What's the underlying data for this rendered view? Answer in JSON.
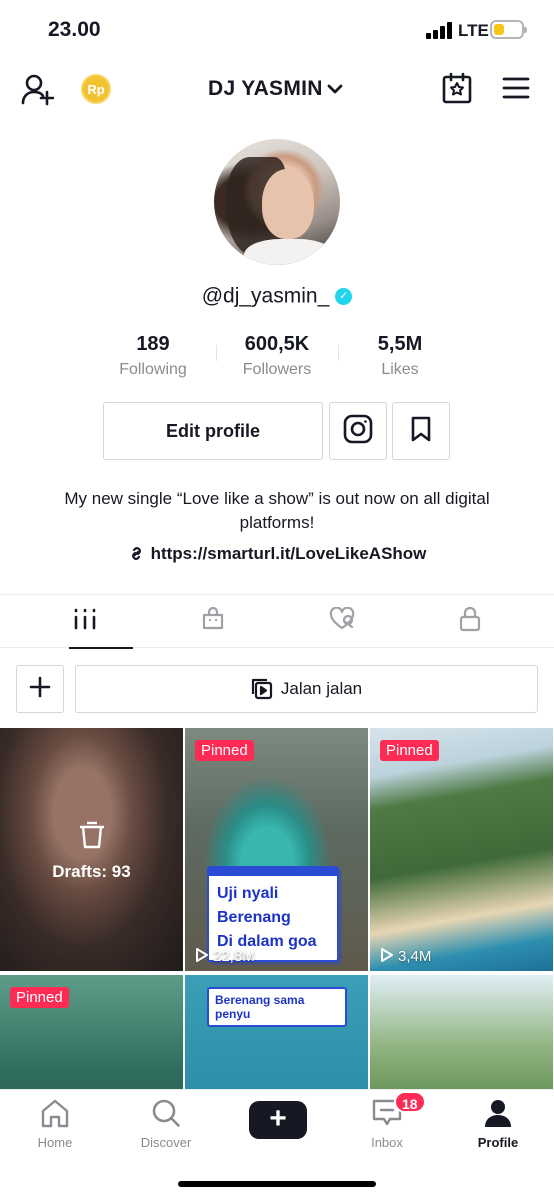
{
  "status": {
    "time": "23.00",
    "network": "LTE",
    "battery_level": 0.4
  },
  "header": {
    "username_title": "DJ YASMIN",
    "coin_label": "Rp",
    "icons": [
      "add-user-icon",
      "chevron-down-icon",
      "calendar-star-icon",
      "hamburger-menu-icon"
    ]
  },
  "profile": {
    "handle": "@dj_yasmin_",
    "verified_mark": "✓",
    "stats": [
      {
        "value": "189",
        "label": "Following"
      },
      {
        "value": "600,5K",
        "label": "Followers"
      },
      {
        "value": "5,5M",
        "label": "Likes"
      }
    ],
    "edit_label": "Edit profile",
    "bio": "My new single “Love like a show” is out now on all digital platforms!",
    "link": "https://smarturl.it/LoveLikeAShow"
  },
  "tabs": [
    {
      "name": "videos",
      "icon": "grid-icon",
      "active": true
    },
    {
      "name": "shop",
      "icon": "shopping-bag-icon",
      "active": false
    },
    {
      "name": "liked",
      "icon": "hidden-heart-icon",
      "active": false
    },
    {
      "name": "private",
      "icon": "lock-icon",
      "active": false
    }
  ],
  "playlist": {
    "label": "Jalan jalan"
  },
  "videos": [
    {
      "drafts": "Drafts: 93"
    },
    {
      "pinned": "Pinned",
      "caption": [
        "Uji nyali",
        "Berenang",
        "Di dalam goa"
      ],
      "views": "22,8M"
    },
    {
      "pinned": "Pinned",
      "views": "3,4M"
    },
    {
      "pinned": "Pinned"
    },
    {
      "caption": [
        "Berenang sama penyu"
      ]
    },
    {}
  ],
  "nav": {
    "home": "Home",
    "discover": "Discover",
    "create": "+",
    "inbox": "Inbox",
    "inbox_badge": "18",
    "profile": "Profile"
  },
  "colors": {
    "accent": "#fe2c55",
    "verified": "#20d5ec",
    "caption_blue": "#1d33c7"
  }
}
